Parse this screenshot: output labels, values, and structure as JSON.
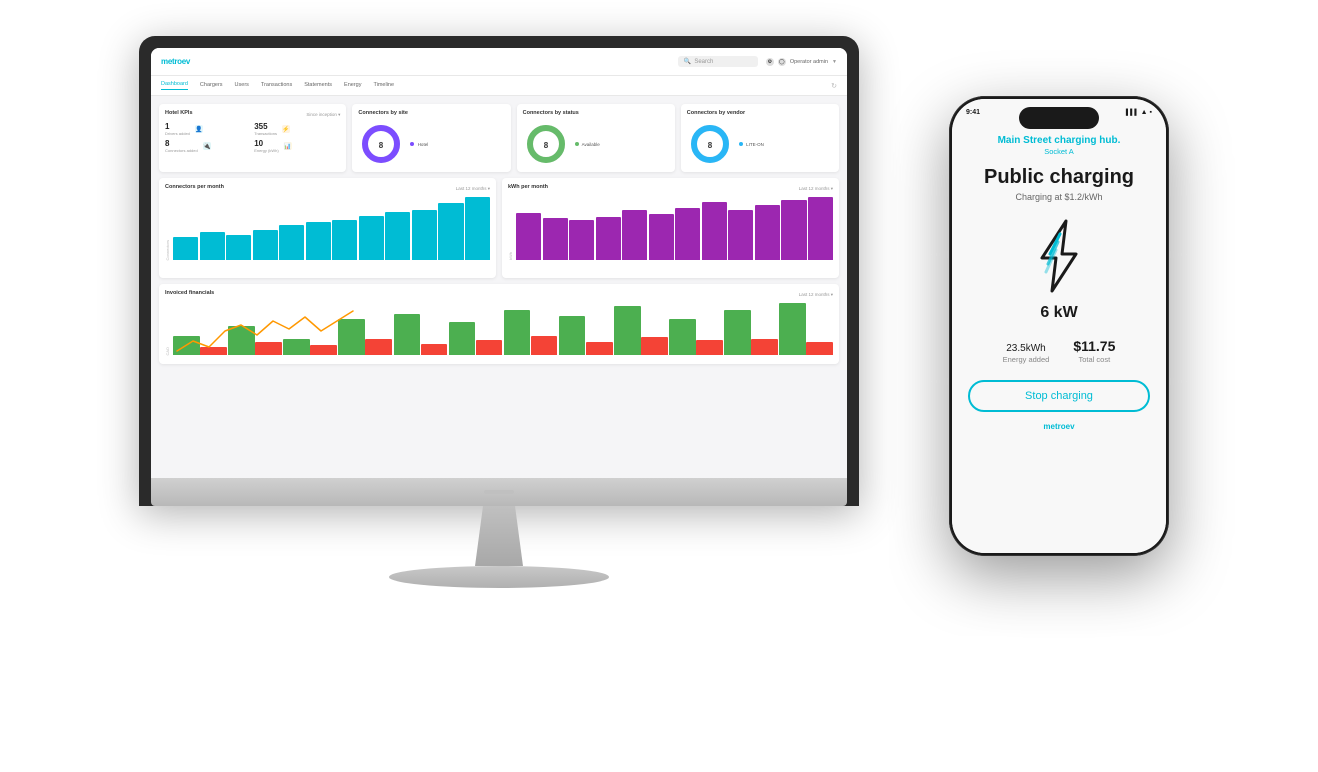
{
  "app": {
    "name": "metro",
    "name_accent": "ev"
  },
  "topbar": {
    "search_placeholder": "Search",
    "operator_label": "Operator admin"
  },
  "nav": {
    "items": [
      "Dashboard",
      "Chargers",
      "Users",
      "Transactions",
      "Statements",
      "Energy",
      "Timeline"
    ]
  },
  "dashboard": {
    "kpi_title": "Hotel KPIs",
    "since_label": "Since inception ▾",
    "drivers_added": "1",
    "drivers_label": "Drivers added",
    "transactions": "355",
    "transactions_label": "Transactions",
    "connectors_added": "8",
    "connectors_label": "Connectors added",
    "energy": "10",
    "energy_label": "Energy (kWh)"
  },
  "connectors_site": {
    "title": "Connectors by site",
    "value": "8",
    "legend": "Hotel",
    "legend_color": "#7c4dff"
  },
  "connectors_status": {
    "title": "Connectors by status",
    "value": "8",
    "legend": "Available",
    "legend_color": "#66bb6a"
  },
  "connectors_vendor": {
    "title": "Connectors by vendor",
    "value": "8",
    "legend": "LITE-ON",
    "legend_color": "#29b6f6"
  },
  "chart_connectors": {
    "title": "Connectors per month",
    "period": "Last 12 months ▾",
    "bars": [
      18,
      22,
      20,
      24,
      28,
      30,
      32,
      35,
      38,
      40,
      45,
      50
    ]
  },
  "chart_kwh": {
    "title": "kWh per month",
    "period": "Last 12 months ▾",
    "bars": [
      900,
      800,
      750,
      820,
      950,
      880,
      1000,
      1100,
      960,
      1050,
      1150,
      1200
    ]
  },
  "chart_financial": {
    "title": "Invoiced financials",
    "period": "Last 12 months ▾",
    "green_bars": [
      12,
      18,
      10,
      22,
      25,
      20,
      28,
      24,
      30,
      22,
      28,
      32
    ],
    "red_bars": [
      5,
      8,
      6,
      10,
      7,
      9,
      12,
      8,
      11,
      9,
      10,
      8
    ]
  },
  "phone": {
    "time": "9:41",
    "site_name": "Main Street charging hub.",
    "socket": "Socket A",
    "title": "Public charging",
    "subtitle": "Charging at $1.2/kWh",
    "power": "6 kW",
    "energy_value": "23.5",
    "energy_unit": "kWh",
    "energy_label": "Energy added",
    "cost_value": "$11.75",
    "cost_label": "Total cost",
    "stop_btn": "Stop charging",
    "logo": "metro",
    "logo_accent": "ev"
  }
}
